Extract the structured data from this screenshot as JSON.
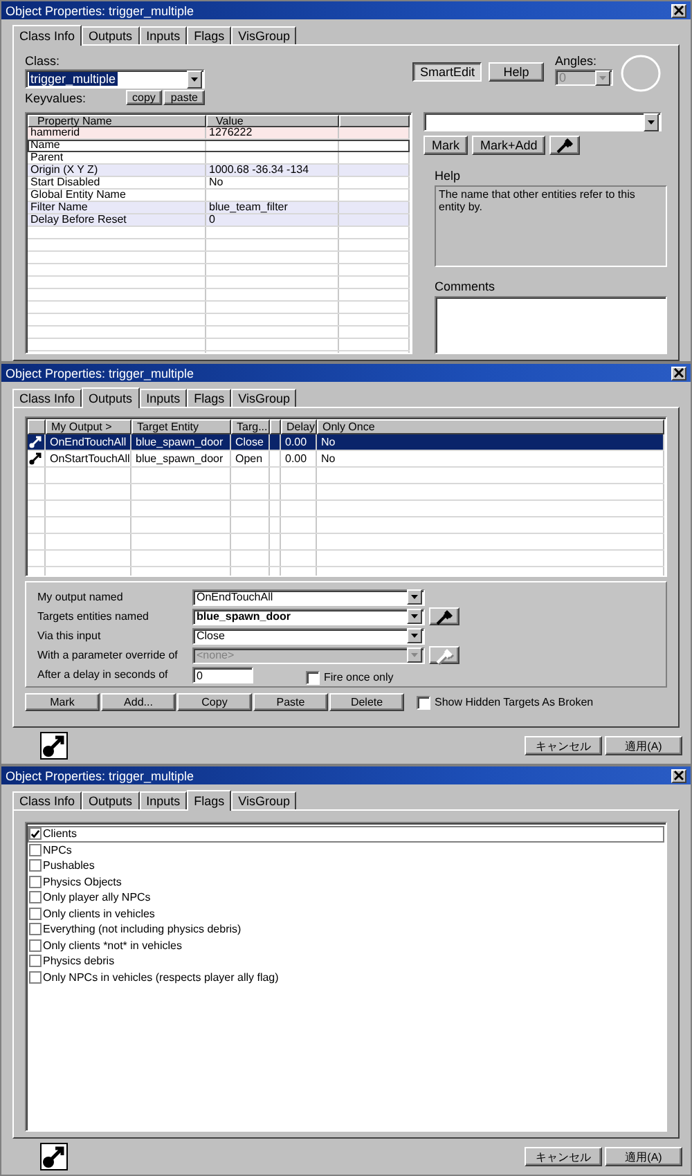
{
  "windows": [
    {
      "kind": "class_info",
      "title": "Object Properties: trigger_multiple",
      "tabs": [
        {
          "label": "Class Info",
          "selected": true
        },
        {
          "label": "Outputs",
          "selected": false
        },
        {
          "label": "Inputs",
          "selected": false
        },
        {
          "label": "Flags",
          "selected": false
        },
        {
          "label": "VisGroup",
          "selected": false
        }
      ],
      "class_label": "Class:",
      "class_value": "trigger_multiple",
      "keyvalues_label": "Keyvalues:",
      "copy_button": "copy",
      "paste_button": "paste",
      "smartedit_button": {
        "label": "SmartEdit",
        "on": true
      },
      "help_button": "Help",
      "angles_label": "Angles:",
      "angles_value": "0",
      "columns": [
        "Property Name",
        "Value"
      ],
      "rows": [
        {
          "name": "hammerid",
          "value": "1276222",
          "selected": false,
          "color": "#fbe8e8"
        },
        {
          "name": "Name",
          "selected": true
        },
        {
          "name": "Parent",
          "selected": false
        },
        {
          "name": "Origin (X Y Z)",
          "value": "1000.68 -36.34 -134",
          "selected": false,
          "color": "#e8e8f8"
        },
        {
          "name": "Start Disabled",
          "value": "No",
          "selected": false
        },
        {
          "name": "Global Entity Name",
          "selected": false
        },
        {
          "name": "Filter Name",
          "value": "blue_team_filter",
          "selected": false,
          "color": "#e8e8f8"
        },
        {
          "name": "Delay Before Reset",
          "value": "0",
          "selected": false,
          "color": "#e8e8f8"
        }
      ],
      "mark_button": "Mark",
      "mark_add_button": "Mark+Add",
      "help_label": "Help",
      "help_text": "The name that other entities refer to this entity by.",
      "comments_label": "Comments"
    },
    {
      "kind": "outputs",
      "title": "Object Properties: trigger_multiple",
      "tabs": [
        {
          "label": "Class Info",
          "selected": false
        },
        {
          "label": "Outputs",
          "selected": true
        },
        {
          "label": "Inputs",
          "selected": false
        },
        {
          "label": "Flags",
          "selected": false
        },
        {
          "label": "VisGroup",
          "selected": false
        }
      ],
      "columns": [
        "My Output >",
        "Target Entity",
        "Targ...",
        "Delay",
        "Only Once"
      ],
      "rows": [
        {
          "output": "OnEndTouchAll",
          "target": "blue_spawn_door",
          "input": "Close",
          "delay": "0.00",
          "once": "No",
          "selected": true
        },
        {
          "output": "OnStartTouchAll",
          "target": "blue_spawn_door",
          "input": "Open",
          "delay": "0.00",
          "once": "No",
          "selected": false
        }
      ],
      "fields": [
        {
          "label": "My output named",
          "value": "OnEndTouchAll",
          "kind": "combo",
          "disabled": false,
          "bold": false,
          "picker": false
        },
        {
          "label": "Targets entities named",
          "value": "blue_spawn_door",
          "kind": "combo",
          "disabled": false,
          "bold": true,
          "picker": true
        },
        {
          "label": "Via this input",
          "value": "Close",
          "kind": "combo",
          "disabled": false,
          "bold": false,
          "picker": false
        },
        {
          "label": "With a parameter override of",
          "value": "<none>",
          "kind": "combo",
          "disabled": true,
          "bold": false,
          "picker": true
        },
        {
          "label": "After a delay in seconds of",
          "value": "0",
          "kind": "number",
          "disabled": false,
          "bold": false,
          "picker": false
        }
      ],
      "fire_once": {
        "label": "Fire once only",
        "checked": false
      },
      "buttons": [
        "Mark",
        "Add...",
        "Copy",
        "Paste",
        "Delete"
      ],
      "show_hidden": {
        "label": "Show Hidden Targets As Broken",
        "checked": false
      },
      "cancel_button": "キャンセル",
      "apply_button": "適用(A)"
    },
    {
      "kind": "flags",
      "title": "Object Properties: trigger_multiple",
      "tabs": [
        {
          "label": "Class Info",
          "selected": false
        },
        {
          "label": "Outputs",
          "selected": false
        },
        {
          "label": "Inputs",
          "selected": false
        },
        {
          "label": "Flags",
          "selected": true
        },
        {
          "label": "VisGroup",
          "selected": false
        }
      ],
      "flags": [
        {
          "label": "Clients",
          "checked": true,
          "selected": true
        },
        {
          "label": "NPCs",
          "checked": false,
          "selected": false
        },
        {
          "label": "Pushables",
          "checked": false,
          "selected": false
        },
        {
          "label": "Physics Objects",
          "checked": false,
          "selected": false
        },
        {
          "label": "Only player ally NPCs",
          "checked": false,
          "selected": false
        },
        {
          "label": "Only clients in vehicles",
          "checked": false,
          "selected": false
        },
        {
          "label": "Everything (not including physics debris)",
          "checked": false,
          "selected": false
        },
        {
          "label": "Only clients *not* in vehicles",
          "checked": false,
          "selected": false
        },
        {
          "label": "Physics debris",
          "checked": false,
          "selected": false
        },
        {
          "label": "Only NPCs in vehicles (respects player ally flag)",
          "checked": false,
          "selected": false
        }
      ],
      "cancel_button": "キャンセル",
      "apply_button": "適用(A)"
    }
  ]
}
